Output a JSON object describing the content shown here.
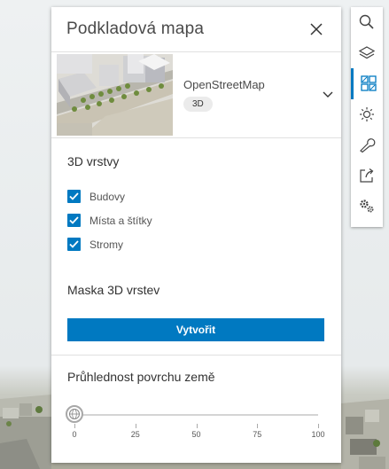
{
  "panel": {
    "title": "Podkladová mapa",
    "basemap": {
      "name": "OpenStreetMap",
      "badge": "3D"
    },
    "layers_title": "3D vrstvy",
    "layers": [
      {
        "label": "Budovy",
        "checked": true
      },
      {
        "label": "Místa a štítky",
        "checked": true
      },
      {
        "label": "Stromy",
        "checked": true
      }
    ],
    "mask_title": "Maska 3D vrstev",
    "create_label": "Vytvořit",
    "transparency_title": "Průhlednost povrchu země",
    "transparency": {
      "value": 0,
      "min": 0,
      "max": 100,
      "ticks": [
        "0",
        "25",
        "50",
        "75",
        "100"
      ]
    }
  },
  "toolbar": {
    "tools": [
      "search-icon",
      "layers-icon",
      "basemap-icon",
      "daylight-icon",
      "wrench-icon",
      "share-icon",
      "settings-icon"
    ],
    "active": "basemap-icon"
  },
  "colors": {
    "accent": "#0079c1"
  }
}
